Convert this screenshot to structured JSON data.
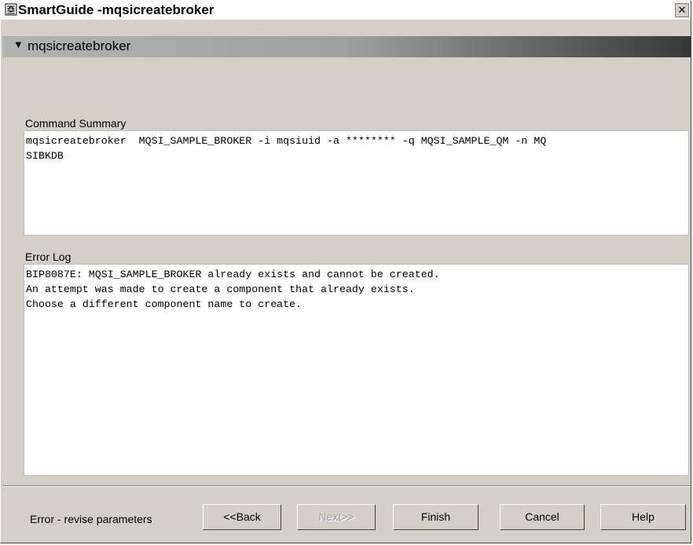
{
  "window": {
    "title": "SmartGuide -mqsicreatebroker",
    "close_glyph": "✕"
  },
  "banner": {
    "text": "mqsicreatebroker"
  },
  "command_summary": {
    "label": "Command Summary",
    "text": "mqsicreatebroker  MQSI_SAMPLE_BROKER -i mqsiuid -a ******** -q MQSI_SAMPLE_QM -n MQ\nSIBKDB"
  },
  "error_log": {
    "label": "Error Log",
    "text": "BIP8087E: MQSI_SAMPLE_BROKER already exists and cannot be created.\nAn attempt was made to create a component that already exists.\nChoose a different component name to create."
  },
  "footer": {
    "status": "Error - revise parameters",
    "buttons": {
      "back": "<<Back",
      "next": "Next>>",
      "finish": "Finish",
      "cancel": "Cancel",
      "help": "Help"
    }
  },
  "colors": {
    "dialog_bg": "#d4d0c8",
    "banner_gradient_start": "#b3b3b3",
    "banner_gradient_end": "#383838",
    "disabled_text": "#a0a0a0"
  },
  "icons": {
    "app": "smartguide-app-icon",
    "close": "close-icon",
    "banner": "triangle-down-icon"
  }
}
